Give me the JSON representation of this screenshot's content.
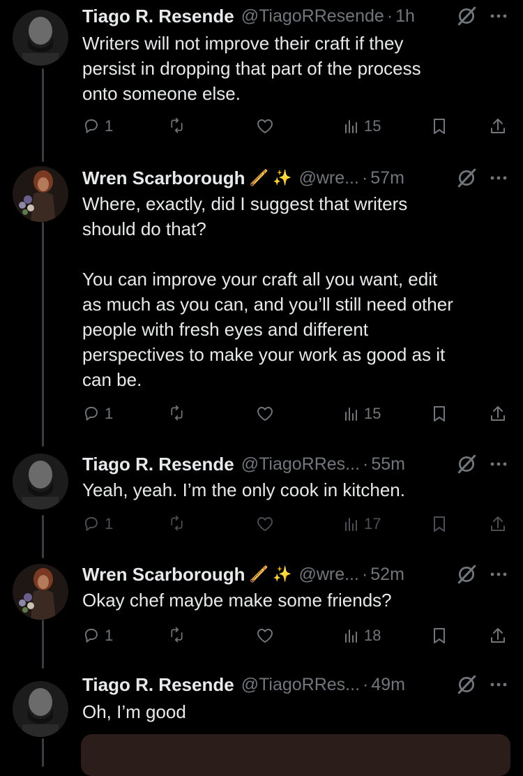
{
  "tweets": [
    {
      "name": "Tiago R. Resende",
      "emoji": "",
      "handle": "@TiagoRResende",
      "time": "1h",
      "text": "Writers will not improve their craft if they\npersist in dropping that part of the process\nonto someone else.",
      "replies": "1",
      "retweets": "",
      "likes": "",
      "views": "15"
    },
    {
      "name": "Wren Scarborough",
      "emoji": "🪈 ✨",
      "handle": "@wre...",
      "time": "57m",
      "text": "Where, exactly, did I suggest that writers\nshould do that?\n\nYou can improve your craft all you want, edit\nas much as you can, and you’ll still need other\npeople with fresh eyes and different\nperspectives to make your work as good as it\ncan be.",
      "replies": "1",
      "retweets": "",
      "likes": "",
      "views": "15"
    },
    {
      "name": "Tiago R. Resende",
      "emoji": "",
      "handle": "@TiagoRRes...",
      "time": "55m",
      "text": "Yeah, yeah. I’m the only cook in kitchen.",
      "replies": "1",
      "retweets": "",
      "likes": "",
      "views": "17"
    },
    {
      "name": "Wren Scarborough",
      "emoji": "🪈 ✨",
      "handle": "@wre...",
      "time": "52m",
      "text": "Okay chef maybe make some friends?",
      "replies": "1",
      "retweets": "",
      "likes": "",
      "views": "18"
    },
    {
      "name": "Tiago R. Resende",
      "emoji": "",
      "handle": "@TiagoRRes...",
      "time": "49m",
      "text": "Oh, I’m good"
    }
  ],
  "colors": {
    "background": "#000000",
    "text": "#e7e9ea",
    "muted": "#71767b",
    "thread_line": "#3a3d40"
  },
  "icons": [
    "grok-icon",
    "more-icon",
    "reply-icon",
    "retweet-icon",
    "like-icon",
    "views-icon",
    "bookmark-icon",
    "share-icon"
  ]
}
